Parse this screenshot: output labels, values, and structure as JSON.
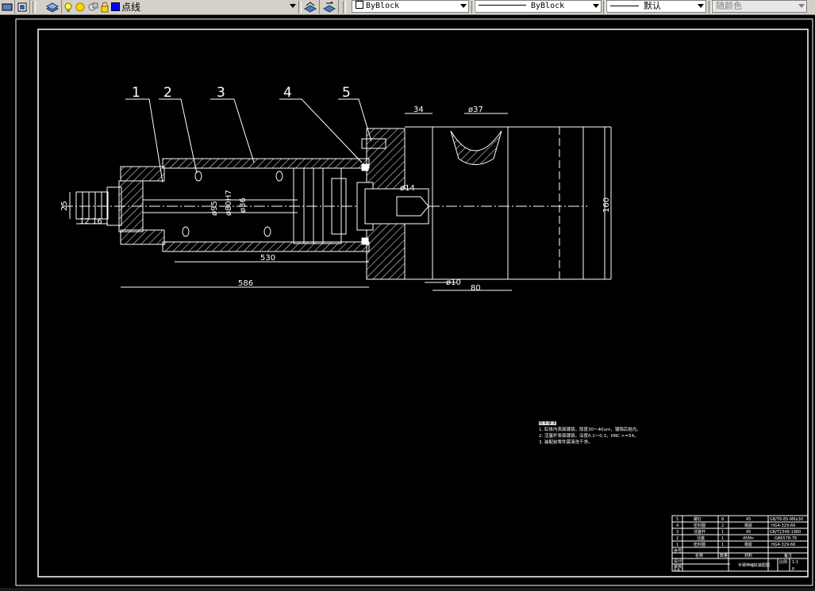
{
  "toolbar": {
    "linetype_label": "点线",
    "color_label": "ByBlock",
    "linetype_value": "ByBlock",
    "lineweight_value": "默认",
    "plotstyle_value": "随颜色"
  },
  "drawing": {
    "balloons": [
      "1",
      "2",
      "3",
      "4",
      "5"
    ],
    "dims": {
      "d34": "34",
      "d37": "ø37",
      "d14": "ø14",
      "d160": "160",
      "d25": "25",
      "d12": "12",
      "d16": "16",
      "d95": "ø95",
      "d80": "ø80H7",
      "d36": "ø36",
      "d530": "530",
      "d586": "586",
      "d10": "ø10",
      "d80b": "80"
    },
    "notes": {
      "title": "技术要求",
      "line1": "1. 缸体内表面镀铬，厚度30～40um，镀铬后抛光。",
      "line2": "2. 活塞杆表面镀铬，深度0.1～0.3，HRC >=54。",
      "line3": "3. 装配前零件需清洗干净。"
    },
    "bom": {
      "rows": [
        {
          "no": "5",
          "name": "螺钉",
          "qty": "8",
          "mat": "45",
          "std": "GB/T6-85-M6x30"
        },
        {
          "no": "4",
          "name": "密封圈",
          "qty": "2",
          "mat": "橡胶",
          "std": "HG4-329-66"
        },
        {
          "no": "3",
          "name": "活塞杆",
          "qty": "1",
          "mat": "45",
          "std": "GB/T2348-1980"
        },
        {
          "no": "2",
          "name": "活塞",
          "qty": "1",
          "mat": "45Mn",
          "std": "GB6578-76"
        },
        {
          "no": "1",
          "name": "密封圈",
          "qty": "1",
          "mat": "橡胶",
          "std": "HG4-329-66"
        }
      ],
      "header": {
        "no": "序号",
        "name": "名称",
        "qty": "数量",
        "mat": "材料",
        "std": "备注"
      },
      "design": "设计",
      "check": "审核",
      "approve": "批准",
      "title": "手臂伸缩缸装配图",
      "scale_label": "比例",
      "scale": "1:1",
      "sheet": "p"
    }
  }
}
